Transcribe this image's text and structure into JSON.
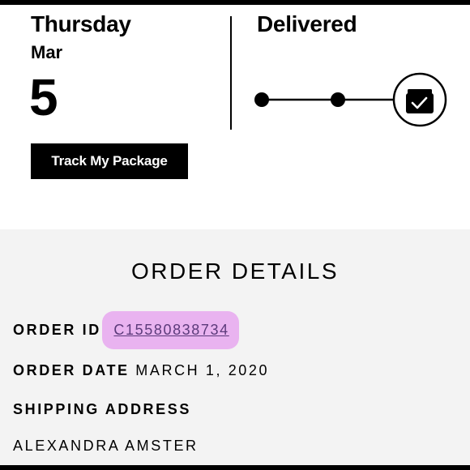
{
  "delivery": {
    "day_name": "Thursday",
    "month": "Mar",
    "day_number": "5",
    "track_button_label": "Track My Package",
    "status": "Delivered",
    "progress_icons": [
      "step-dot-icon",
      "step-dot-icon",
      "package-check-icon"
    ]
  },
  "order_details": {
    "title": "ORDER DETAILS",
    "order_id_label": "ORDER ID",
    "order_id_value": "C15580838734",
    "order_date_label": "ORDER DATE",
    "order_date_value": "MARCH 1, 2020",
    "shipping_address_label": "SHIPPING ADDRESS",
    "recipient_name": "ALEXANDRA AMSTER"
  },
  "colors": {
    "highlight": "#e9b3f0",
    "link": "#5b3a7a",
    "details_background": "#f3f3f3"
  }
}
